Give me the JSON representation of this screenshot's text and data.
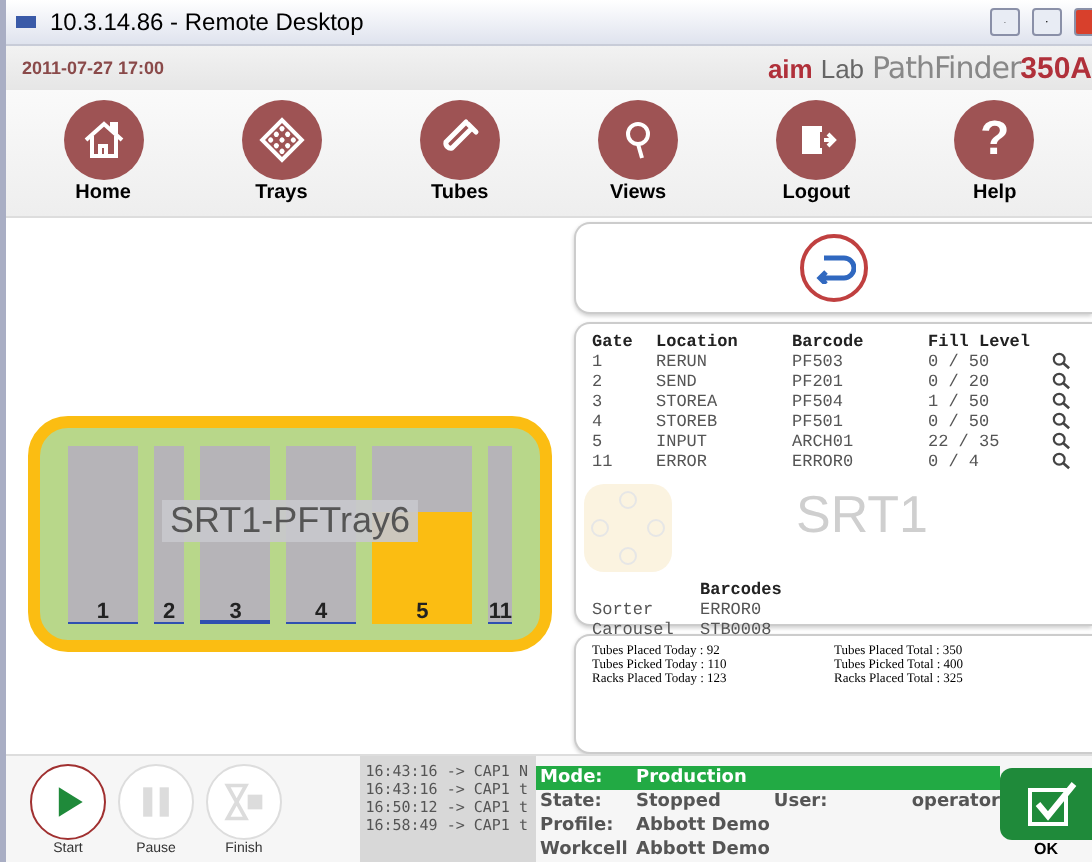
{
  "window": {
    "title": "10.3.14.86 - Remote Desktop"
  },
  "header": {
    "datetime": "2011-07-27 17:00",
    "brand_left": "aim",
    "brand_mid": "Lab",
    "product": "PathFinder",
    "model": "350A"
  },
  "nav": [
    {
      "label": "Home",
      "kind": "home"
    },
    {
      "label": "Trays",
      "kind": "trays"
    },
    {
      "label": "Tubes",
      "kind": "tubes"
    },
    {
      "label": "Views",
      "kind": "views"
    },
    {
      "label": "Logout",
      "kind": "logout"
    },
    {
      "label": "Help",
      "kind": "help",
      "glyph": "?"
    }
  ],
  "tray": {
    "name": "SRT1-PFTray6",
    "bins": [
      {
        "label": "1",
        "level": 0
      },
      {
        "label": "2",
        "level": 0
      },
      {
        "label": "3",
        "level": 0.02
      },
      {
        "label": "4",
        "level": 0
      },
      {
        "label": "5",
        "level": 0.63
      },
      {
        "label": "11",
        "level": 0
      }
    ]
  },
  "gates": {
    "watermark": "SRT1",
    "columns": [
      "Gate",
      "Location",
      "Barcode",
      "Fill Level"
    ],
    "rows": [
      [
        "1",
        "RERUN",
        "PF503",
        "0 / 50"
      ],
      [
        "2",
        "SEND",
        "PF201",
        "0 / 20"
      ],
      [
        "3",
        "STOREA",
        "PF504",
        "1 / 50"
      ],
      [
        "4",
        "STOREB",
        "PF501",
        "0 / 50"
      ],
      [
        "5",
        "INPUT",
        "ARCH01",
        "22 / 35"
      ],
      [
        "11",
        "ERROR",
        "ERROR0",
        "0 / 4"
      ]
    ],
    "barcodes_heading": "Barcodes",
    "barcodes": [
      [
        "Sorter",
        "ERROR0"
      ],
      [
        "Carousel",
        "STB0008"
      ]
    ]
  },
  "stats": [
    [
      "Tubes Placed Today : 92",
      "Tubes Placed Total : 350"
    ],
    [
      "Tubes Picked Today : 110",
      "Tubes Picked Total : 400"
    ],
    [
      "Racks Placed Today : 123",
      "Racks Placed Total : 325"
    ]
  ],
  "controls": [
    {
      "label": "Start",
      "kind": "play",
      "disabled": false
    },
    {
      "label": "Pause",
      "kind": "pause",
      "disabled": true
    },
    {
      "label": "Finish",
      "kind": "finish",
      "disabled": true
    }
  ],
  "log": [
    "16:43:16 -> CAP1 N",
    "16:43:16 -> CAP1 t",
    "16:50:12 -> CAP1 t",
    "16:58:49 -> CAP1 t"
  ],
  "status": {
    "mode_label": "Mode:",
    "mode": "Production",
    "state_label": "State:",
    "state": "Stopped",
    "user_label": "User:",
    "user": "operator",
    "profile_label": "Profile:",
    "profile": "Abbott Demo",
    "workcell_label": "Workcell",
    "workcell": "Abbott Demo"
  },
  "ok": {
    "label": "OK"
  }
}
